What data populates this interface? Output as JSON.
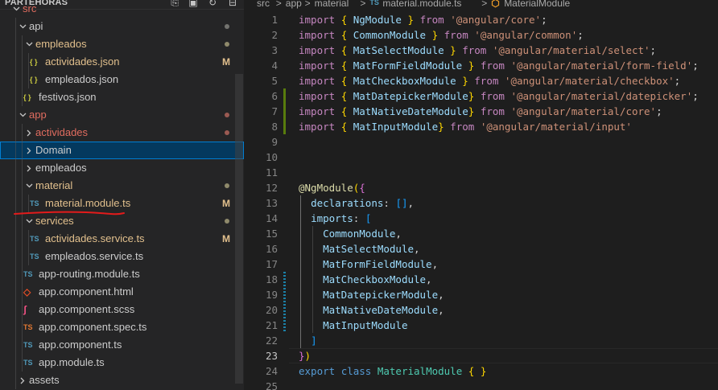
{
  "explorer": {
    "title": "PARTEHORAS",
    "actions": [
      {
        "name": "new-file-icon",
        "glyph": "⎘"
      },
      {
        "name": "new-folder-icon",
        "glyph": "▣"
      },
      {
        "name": "refresh-icon",
        "glyph": "↻"
      },
      {
        "name": "collapse-all-icon",
        "glyph": "⊟"
      }
    ],
    "items": [
      {
        "label": "src",
        "type": "folder",
        "open": true,
        "depth": 0,
        "status": "red"
      },
      {
        "label": "api",
        "type": "folder",
        "open": true,
        "depth": 1,
        "status": "dot",
        "dot": "#73736f"
      },
      {
        "label": "empleados",
        "type": "folder",
        "open": true,
        "depth": 2,
        "status": "dot",
        "dot": "#8f8a6b",
        "mod": true
      },
      {
        "label": "actividades.json",
        "type": "json",
        "depth": 3,
        "status": "M",
        "mod": true
      },
      {
        "label": "empleados.json",
        "type": "json",
        "depth": 3
      },
      {
        "label": "festivos.json",
        "type": "json",
        "depth": 2
      },
      {
        "label": "app",
        "type": "folder",
        "open": true,
        "depth": 1,
        "status": "dot",
        "dot": "#9b5a52",
        "red": true
      },
      {
        "label": "actividades",
        "type": "folder",
        "open": false,
        "depth": 2,
        "status": "dot",
        "dot": "#9b5a52",
        "red": true
      },
      {
        "label": "Domain",
        "type": "folder",
        "open": false,
        "depth": 2,
        "selected": true
      },
      {
        "label": "empleados",
        "type": "folder",
        "open": false,
        "depth": 2
      },
      {
        "label": "material",
        "type": "folder",
        "open": true,
        "depth": 2,
        "status": "dot",
        "dot": "#8f8a6b",
        "mod": true
      },
      {
        "label": "material.module.ts",
        "type": "ts",
        "depth": 3,
        "status": "M",
        "mod": true
      },
      {
        "label": "services",
        "type": "folder",
        "open": true,
        "depth": 2,
        "status": "dot",
        "dot": "#8f8a6b",
        "mod": true
      },
      {
        "label": "actividades.service.ts",
        "type": "ts",
        "depth": 3,
        "status": "M",
        "mod": true
      },
      {
        "label": "empleados.service.ts",
        "type": "ts",
        "depth": 3
      },
      {
        "label": "app-routing.module.ts",
        "type": "ts",
        "depth": 2
      },
      {
        "label": "app.component.html",
        "type": "html",
        "depth": 2
      },
      {
        "label": "app.component.scss",
        "type": "scss",
        "depth": 2
      },
      {
        "label": "app.component.spec.ts",
        "type": "spec",
        "depth": 2
      },
      {
        "label": "app.component.ts",
        "type": "ts",
        "depth": 2
      },
      {
        "label": "app.module.ts",
        "type": "ts",
        "depth": 2
      },
      {
        "label": "assets",
        "type": "folder",
        "open": false,
        "depth": 1
      }
    ],
    "file_icons": {
      "json": "{ }",
      "ts": "TS",
      "spec": "TS",
      "html": "◇",
      "scss": "ʃ"
    },
    "status_m": "M"
  },
  "breadcrumb": [
    "src",
    ">",
    "app",
    ">",
    "material",
    ">",
    "TS",
    "material.module.ts",
    ">",
    "⬡",
    "MaterialModule"
  ],
  "editor": {
    "active_line": 23,
    "modified_lines": [
      6,
      7,
      8
    ],
    "lines": [
      [
        [
          "kw",
          "import"
        ],
        [
          "punc",
          " "
        ],
        [
          "br1",
          "{"
        ],
        [
          "punc",
          " "
        ],
        [
          "id",
          "NgModule"
        ],
        [
          "punc",
          " "
        ],
        [
          "br1",
          "}"
        ],
        [
          "punc",
          " "
        ],
        [
          "kw",
          "from"
        ],
        [
          "punc",
          " "
        ],
        [
          "str",
          "'@angular/core'"
        ],
        [
          "punc",
          ";"
        ]
      ],
      [
        [
          "kw",
          "import"
        ],
        [
          "punc",
          " "
        ],
        [
          "br1",
          "{"
        ],
        [
          "punc",
          " "
        ],
        [
          "id",
          "CommonModule"
        ],
        [
          "punc",
          " "
        ],
        [
          "br1",
          "}"
        ],
        [
          "punc",
          " "
        ],
        [
          "kw",
          "from"
        ],
        [
          "punc",
          " "
        ],
        [
          "str",
          "'@angular/common'"
        ],
        [
          "punc",
          ";"
        ]
      ],
      [
        [
          "kw",
          "import"
        ],
        [
          "punc",
          " "
        ],
        [
          "br1",
          "{"
        ],
        [
          "punc",
          " "
        ],
        [
          "id",
          "MatSelectModule"
        ],
        [
          "punc",
          " "
        ],
        [
          "br1",
          "}"
        ],
        [
          "punc",
          " "
        ],
        [
          "kw",
          "from"
        ],
        [
          "punc",
          " "
        ],
        [
          "str",
          "'@angular/material/select'"
        ],
        [
          "punc",
          ";"
        ]
      ],
      [
        [
          "kw",
          "import"
        ],
        [
          "punc",
          " "
        ],
        [
          "br1",
          "{"
        ],
        [
          "punc",
          " "
        ],
        [
          "id",
          "MatFormFieldModule"
        ],
        [
          "punc",
          " "
        ],
        [
          "br1",
          "}"
        ],
        [
          "punc",
          " "
        ],
        [
          "kw",
          "from"
        ],
        [
          "punc",
          " "
        ],
        [
          "str",
          "'@angular/material/form-field'"
        ],
        [
          "punc",
          ";"
        ]
      ],
      [
        [
          "kw",
          "import"
        ],
        [
          "punc",
          " "
        ],
        [
          "br1",
          "{"
        ],
        [
          "punc",
          " "
        ],
        [
          "id",
          "MatCheckboxModule"
        ],
        [
          "punc",
          " "
        ],
        [
          "br1",
          "}"
        ],
        [
          "punc",
          " "
        ],
        [
          "kw",
          "from"
        ],
        [
          "punc",
          " "
        ],
        [
          "str",
          "'@angular/material/checkbox'"
        ],
        [
          "punc",
          ";"
        ]
      ],
      [
        [
          "kw",
          "import"
        ],
        [
          "punc",
          " "
        ],
        [
          "br1",
          "{"
        ],
        [
          "punc",
          " "
        ],
        [
          "id",
          "MatDatepickerModule"
        ],
        [
          "br1",
          "}"
        ],
        [
          "punc",
          " "
        ],
        [
          "kw",
          "from"
        ],
        [
          "punc",
          " "
        ],
        [
          "str",
          "'@angular/material/datepicker'"
        ],
        [
          "punc",
          ";"
        ]
      ],
      [
        [
          "kw",
          "import"
        ],
        [
          "punc",
          " "
        ],
        [
          "br1",
          "{"
        ],
        [
          "punc",
          " "
        ],
        [
          "id",
          "MatNativeDateModule"
        ],
        [
          "br1",
          "}"
        ],
        [
          "punc",
          " "
        ],
        [
          "kw",
          "from"
        ],
        [
          "punc",
          " "
        ],
        [
          "str",
          "'@angular/material/core'"
        ],
        [
          "punc",
          ";"
        ]
      ],
      [
        [
          "kw",
          "import"
        ],
        [
          "punc",
          " "
        ],
        [
          "br1",
          "{"
        ],
        [
          "punc",
          " "
        ],
        [
          "id",
          "MatInputModule"
        ],
        [
          "br1",
          "}"
        ],
        [
          "punc",
          " "
        ],
        [
          "kw",
          "from"
        ],
        [
          "punc",
          " "
        ],
        [
          "str",
          "'@angular/material/input'"
        ]
      ],
      [],
      [],
      [],
      [
        [
          "fn",
          "@NgModule"
        ],
        [
          "br1",
          "("
        ],
        [
          "br2",
          "{"
        ]
      ],
      [
        [
          "punc",
          "  "
        ],
        [
          "prop",
          "declarations"
        ],
        [
          "punc",
          ": "
        ],
        [
          "br3",
          "[]"
        ],
        [
          "punc",
          ","
        ]
      ],
      [
        [
          "punc",
          "  "
        ],
        [
          "prop",
          "imports"
        ],
        [
          "punc",
          ": "
        ],
        [
          "br3",
          "["
        ]
      ],
      [
        [
          "punc",
          "    "
        ],
        [
          "id",
          "CommonModule"
        ],
        [
          "punc",
          ","
        ]
      ],
      [
        [
          "punc",
          "    "
        ],
        [
          "id",
          "MatSelectModule"
        ],
        [
          "punc",
          ","
        ]
      ],
      [
        [
          "punc",
          "    "
        ],
        [
          "id",
          "MatFormFieldModule"
        ],
        [
          "punc",
          ","
        ]
      ],
      [
        [
          "punc",
          "    "
        ],
        [
          "id",
          "MatCheckboxModule"
        ],
        [
          "punc",
          ","
        ]
      ],
      [
        [
          "punc",
          "    "
        ],
        [
          "id",
          "MatDatepickerModule"
        ],
        [
          "punc",
          ","
        ]
      ],
      [
        [
          "punc",
          "    "
        ],
        [
          "id",
          "MatNativeDateModule"
        ],
        [
          "punc",
          ","
        ]
      ],
      [
        [
          "punc",
          "    "
        ],
        [
          "id",
          "MatInputModule"
        ]
      ],
      [
        [
          "punc",
          "  "
        ],
        [
          "br3",
          "]"
        ]
      ],
      [
        [
          "br2",
          "}"
        ],
        [
          "br1",
          ")"
        ]
      ],
      [
        [
          "kw2",
          "export"
        ],
        [
          "punc",
          " "
        ],
        [
          "kw2",
          "class"
        ],
        [
          "punc",
          " "
        ],
        [
          "cls",
          "MaterialModule"
        ],
        [
          "punc",
          " "
        ],
        [
          "br1",
          "{"
        ],
        [
          "punc",
          " "
        ],
        [
          "br1",
          "}"
        ]
      ],
      []
    ]
  },
  "colors": {
    "accent": "#007fd4",
    "selected_bg": "#04395e",
    "modified": "#e2c08d",
    "error": "#e06c5f",
    "gutter_added": "#587c0c"
  }
}
